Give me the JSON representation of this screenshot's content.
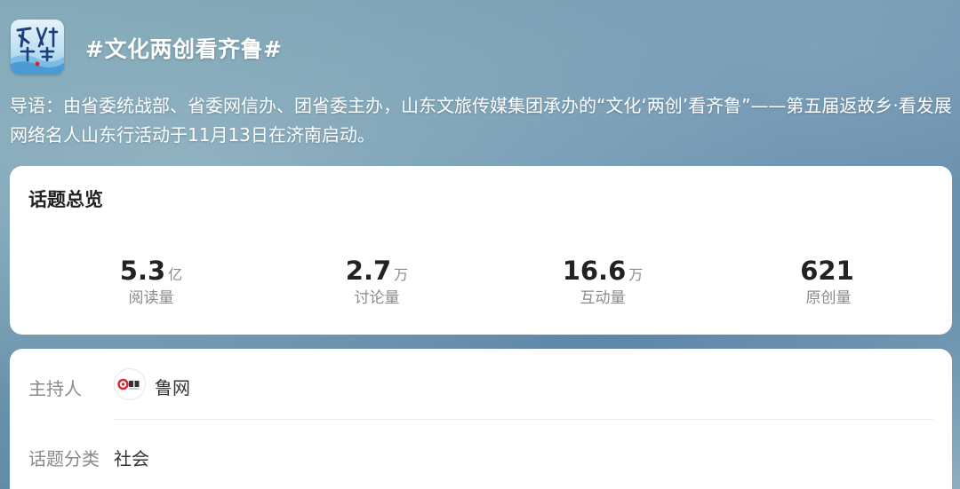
{
  "header": {
    "logo_icon": "topic-logo-icon",
    "title": "#文化两创看齐鲁#",
    "intro": "导语：由省委统战部、省委网信办、团省委主办，山东文旅传媒集团承办的“文化‘两创’看齐鲁”——第五届返故乡·看发展网络名人山东行活动于11月13日在济南启动。"
  },
  "overview": {
    "title": "话题总览",
    "stats": [
      {
        "value": "5.3",
        "unit": "亿",
        "label": "阅读量"
      },
      {
        "value": "2.7",
        "unit": "万",
        "label": "讨论量"
      },
      {
        "value": "16.6",
        "unit": "万",
        "label": "互动量"
      },
      {
        "value": "621",
        "unit": "",
        "label": "原创量"
      }
    ]
  },
  "info": {
    "host_label": "主持人",
    "host_avatar_icon": "luwang-logo-icon",
    "host_name": "鲁网",
    "category_label": "话题分类",
    "category_value": "社会"
  },
  "colors": {
    "card_bg": "#ffffff",
    "primary_text": "#222222",
    "secondary_text": "#8a8a8a",
    "logo_red": "#d8262e"
  }
}
